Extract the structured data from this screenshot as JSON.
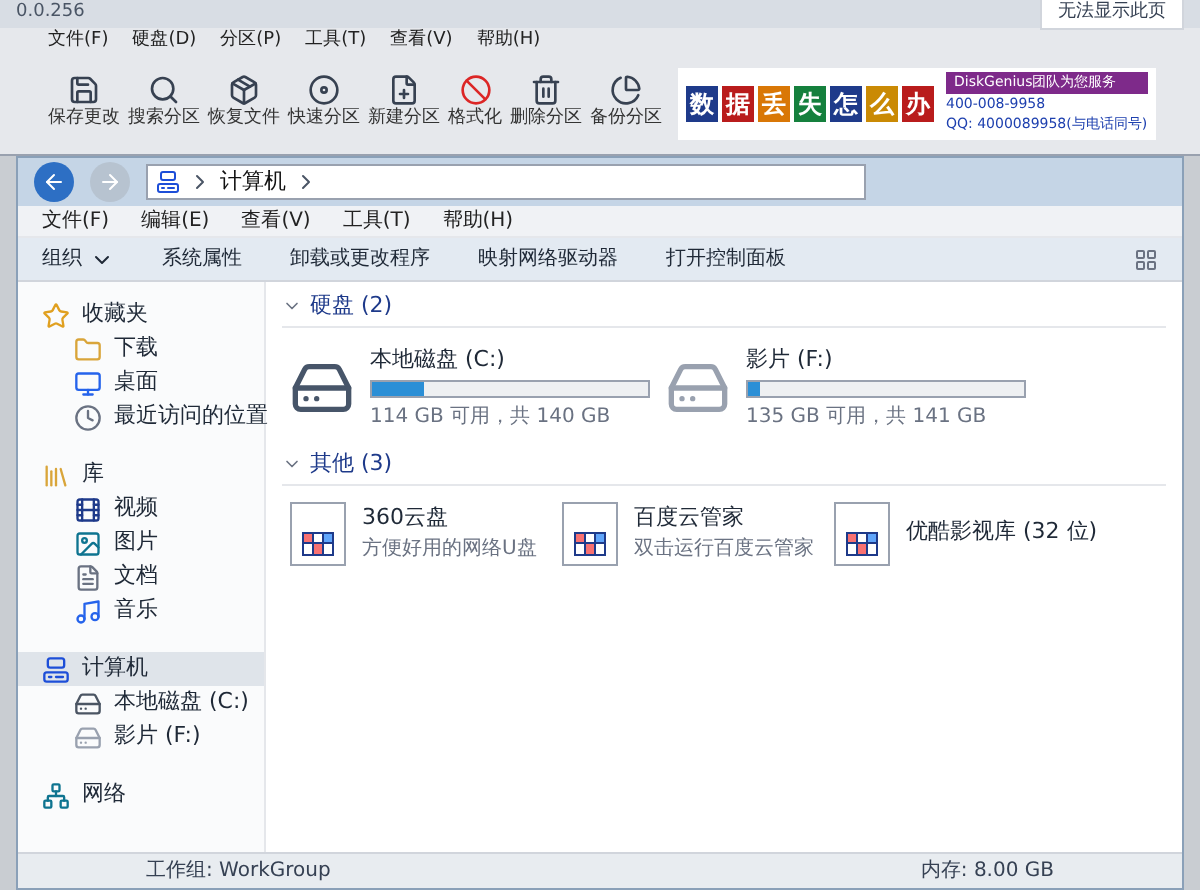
{
  "background_window": {
    "title": "0.0.256",
    "browser_tab": "无法显示此页",
    "menu": [
      "文件(F)",
      "硬盘(D)",
      "分区(P)",
      "工具(T)",
      "查看(V)",
      "帮助(H)"
    ],
    "toolbar": [
      "保存更改",
      "搜索分区",
      "恢复文件",
      "快速分区",
      "新建分区",
      "格式化",
      "删除分区",
      "备份分区"
    ],
    "banner": {
      "chars": [
        "数",
        "据",
        "丢",
        "失",
        "怎",
        "么",
        "办"
      ],
      "team": "DiskGenius团队为您服务",
      "phone": "400-008-9958",
      "qq": "QQ: 4000089958(与电话同号)"
    }
  },
  "window": {
    "address": [
      "计算机"
    ],
    "menu": [
      "文件(F)",
      "编辑(E)",
      "查看(V)",
      "工具(T)",
      "帮助(H)"
    ],
    "toolbar": [
      "组织",
      "系统属性",
      "卸载或更改程序",
      "映射网络驱动器",
      "打开控制面板"
    ],
    "sidebar": [
      {
        "label": "收藏夹",
        "kind": "star",
        "selected": false,
        "children": [
          {
            "label": "下载",
            "kind": "folder",
            "selected": false
          },
          {
            "label": "桌面",
            "kind": "desktop",
            "selected": false
          },
          {
            "label": "最近访问的位置",
            "kind": "recent",
            "selected": false
          }
        ]
      },
      {
        "label": "库",
        "kind": "library",
        "selected": false,
        "children": [
          {
            "label": "视频",
            "kind": "video",
            "selected": false
          },
          {
            "label": "图片",
            "kind": "image",
            "selected": false
          },
          {
            "label": "文档",
            "kind": "doc",
            "selected": false
          },
          {
            "label": "音乐",
            "kind": "music",
            "selected": false
          }
        ]
      },
      {
        "label": "计算机",
        "kind": "computer",
        "selected": true,
        "children": [
          {
            "label": "本地磁盘 (C:)",
            "kind": "sysdrive",
            "selected": false
          },
          {
            "label": "影片 (F:)",
            "kind": "drive",
            "selected": false
          }
        ]
      },
      {
        "label": "网络",
        "kind": "network",
        "selected": false
      }
    ],
    "groups": [
      {
        "title": "硬盘 (2)",
        "kind": "drives",
        "items": [
          {
            "name": "本地磁盘 (C:)",
            "kind": "sysdrive",
            "level": 0.19,
            "detail": "114 GB 可用，共 140 GB"
          },
          {
            "name": "影片 (F:)",
            "kind": "drive",
            "level": 0.04,
            "detail": "135 GB 可用，共 141 GB"
          }
        ]
      },
      {
        "title": "其他 (3)",
        "kind": "apps",
        "items": [
          {
            "name": "360云盘",
            "detail": "方便好用的网络U盘"
          },
          {
            "name": "百度云管家",
            "detail": "双击运行百度云管家"
          },
          {
            "name": "优酷影视库 (32 位)"
          }
        ]
      }
    ],
    "status_bar": [
      "工作组: WorkGroup",
      "内存: 8.00 GB"
    ]
  }
}
